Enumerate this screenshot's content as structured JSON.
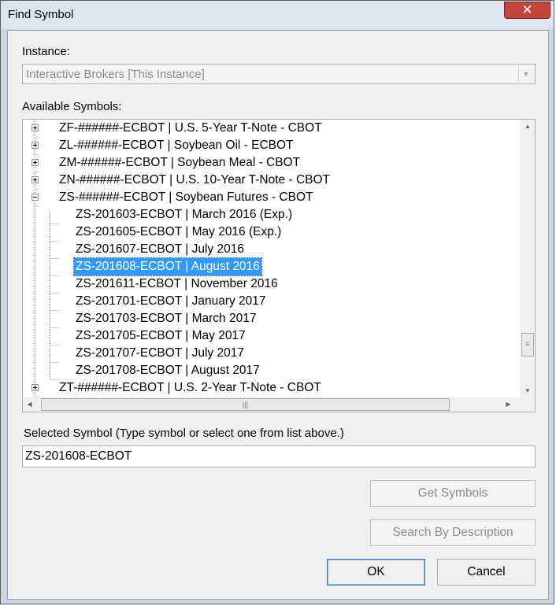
{
  "window": {
    "title": "Find Symbol",
    "close_glyph": "✕"
  },
  "instance": {
    "label": "Instance:",
    "selected": "Interactive Brokers [This Instance]"
  },
  "symbols": {
    "label": "Available Symbols:",
    "nodes": [
      {
        "text": "ZF-######-ECBOT  |  U.S. 5-Year T-Note - CBOT",
        "level": 0,
        "state": "collapsed"
      },
      {
        "text": "ZL-######-ECBOT  |  Soybean Oil - ECBOT",
        "level": 0,
        "state": "collapsed"
      },
      {
        "text": "ZM-######-ECBOT  |  Soybean Meal - CBOT",
        "level": 0,
        "state": "collapsed"
      },
      {
        "text": "ZN-######-ECBOT  |  U.S. 10-Year T-Note - CBOT",
        "level": 0,
        "state": "collapsed"
      },
      {
        "text": "ZS-######-ECBOT  |  Soybean Futures - CBOT",
        "level": 0,
        "state": "expanded"
      },
      {
        "text": "ZS-201603-ECBOT  |  March 2016 (Exp.)",
        "level": 1
      },
      {
        "text": "ZS-201605-ECBOT  |  May 2016 (Exp.)",
        "level": 1
      },
      {
        "text": "ZS-201607-ECBOT  |  July 2016",
        "level": 1
      },
      {
        "text": "ZS-201608-ECBOT  |  August 2016",
        "level": 1,
        "selected": true
      },
      {
        "text": "ZS-201611-ECBOT  |  November 2016",
        "level": 1
      },
      {
        "text": "ZS-201701-ECBOT  |  January 2017",
        "level": 1
      },
      {
        "text": "ZS-201703-ECBOT  |  March 2017",
        "level": 1
      },
      {
        "text": "ZS-201705-ECBOT  |  May 2017",
        "level": 1
      },
      {
        "text": "ZS-201707-ECBOT  |  July 2017",
        "level": 1
      },
      {
        "text": "ZS-201708-ECBOT  |  August 2017",
        "level": 1
      },
      {
        "text": "ZT-######-ECBOT  |  U.S. 2-Year T-Note - CBOT",
        "level": 0,
        "state": "collapsed"
      }
    ]
  },
  "selected_symbol": {
    "label": "Selected Symbol (Type symbol or select one from list above.)",
    "value": "ZS-201608-ECBOT"
  },
  "buttons": {
    "get_symbols": "Get Symbols",
    "search_by_description": "Search By Description",
    "ok": "OK",
    "cancel": "Cancel"
  },
  "scrollbar_glyphs": {
    "up": "▲",
    "down": "▼",
    "left": "◀",
    "right": "▶",
    "grip_v": "≡",
    "grip_h": "|||"
  }
}
